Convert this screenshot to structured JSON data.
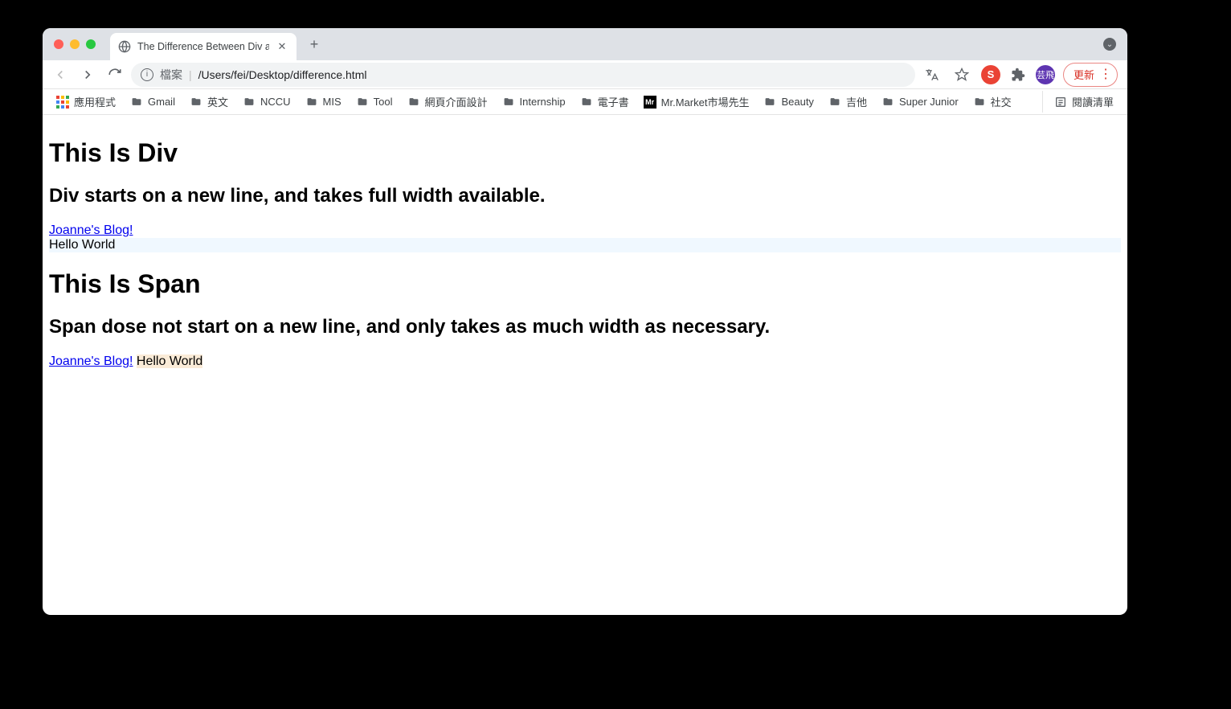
{
  "tab": {
    "title": "The Difference Between Div an"
  },
  "address": {
    "label": "檔案",
    "path": "/Users/fei/Desktop/difference.html"
  },
  "toolbar": {
    "update_label": "更新",
    "user_badge": "芸飛"
  },
  "bookmarks": {
    "apps": "應用程式",
    "items": [
      "Gmail",
      "英文",
      "NCCU",
      "MIS",
      "Tool",
      "網頁介面設計",
      "Internship",
      "電子書"
    ],
    "mr_market": "Mr.Market市場先生",
    "items2": [
      "Beauty",
      "吉他",
      "Super Junior",
      "社交"
    ],
    "reading_list": "閱讀清單"
  },
  "content": {
    "h1_div": "This Is Div",
    "h2_div": "Div starts on a new line, and takes full width available.",
    "link1": "Joanne's Blog!",
    "div_text": "Hello World",
    "h1_span": "This Is Span",
    "h2_span": "Span dose not start on a new line, and only takes as much width as necessary.",
    "link2": "Joanne's Blog!",
    "span_text": "Hello World"
  }
}
